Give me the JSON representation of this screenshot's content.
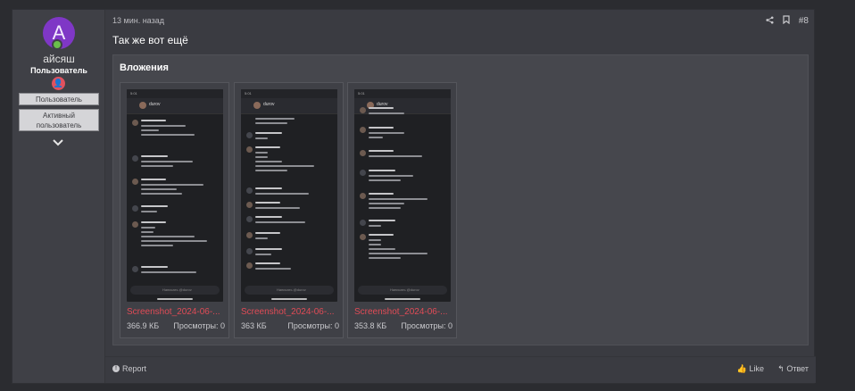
{
  "user": {
    "avatar_letter": "A",
    "avatar_color": "#7f37c6",
    "username": "айсяш",
    "title": "Пользователь",
    "banners": [
      "Пользователь",
      "Активный пользователь"
    ]
  },
  "post": {
    "time": "13 мин. назад",
    "number": "#8",
    "text": "Так же вот ещё"
  },
  "attachments": {
    "title": "Вложения",
    "items": [
      {
        "name": "Screenshot_2024-06-...",
        "size": "366.9 КБ",
        "views": "Просмотры: 0"
      },
      {
        "name": "Screenshot_2024-06-...",
        "size": "363 КБ",
        "views": "Просмотры: 0"
      },
      {
        "name": "Screenshot_2024-06-...",
        "size": "353.8 КБ",
        "views": "Просмотры: 0"
      }
    ]
  },
  "footer": {
    "report": "Report",
    "like": "Like",
    "reply": "Ответ"
  },
  "colors": {
    "accent_link": "#e04b56",
    "online": "#6abf4b"
  }
}
